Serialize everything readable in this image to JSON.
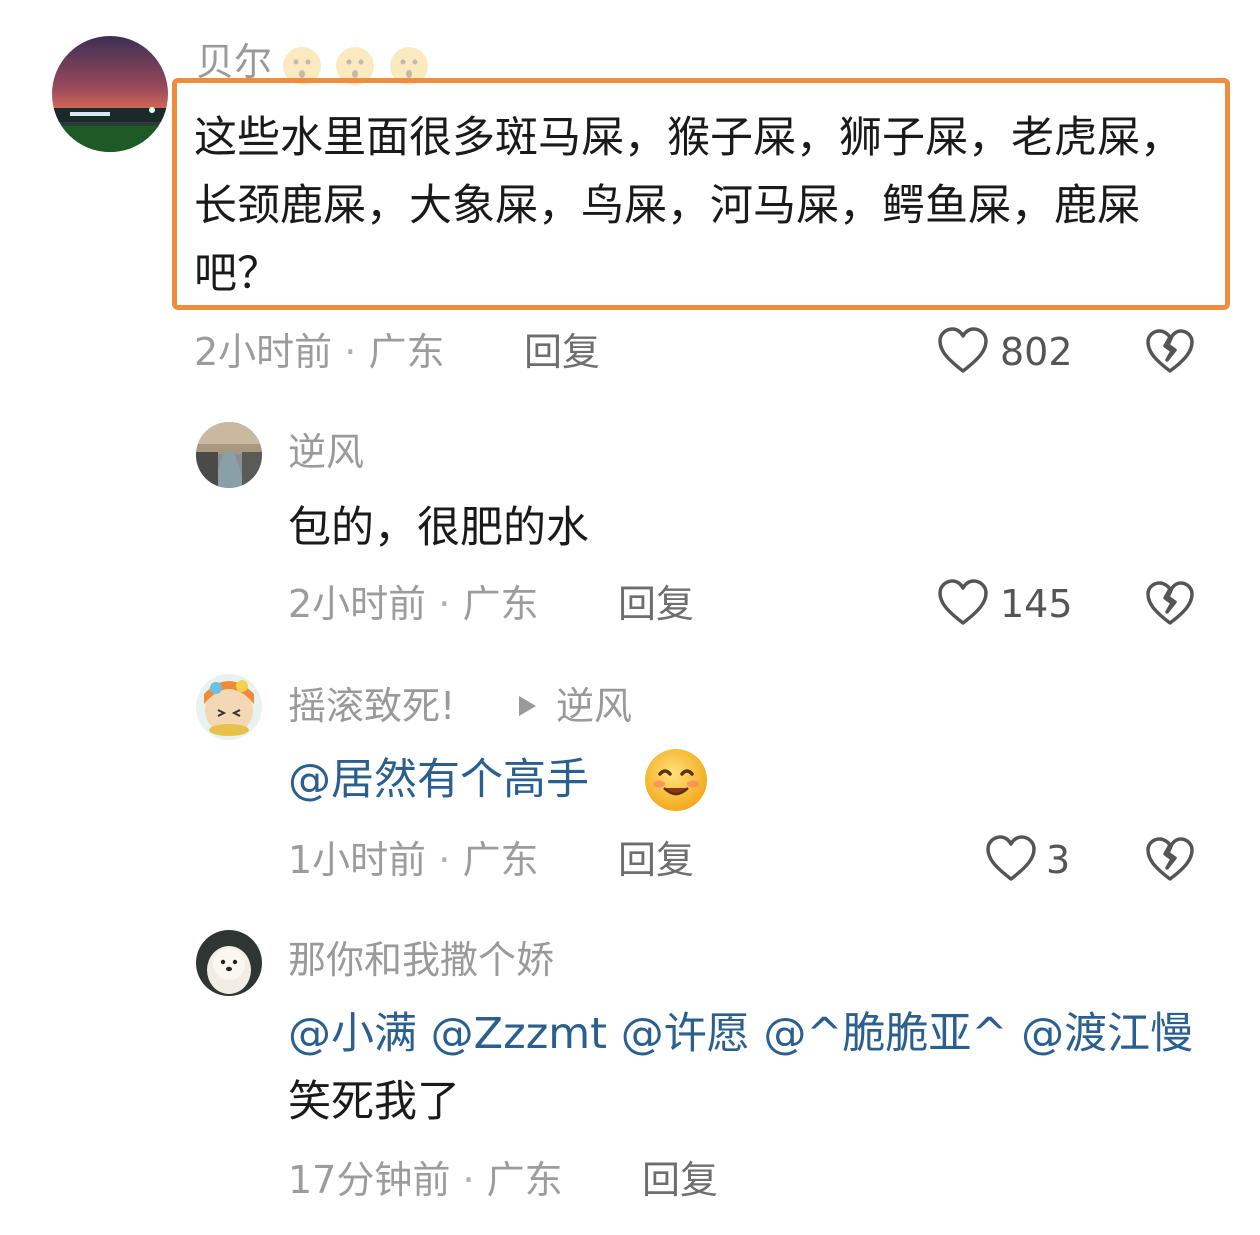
{
  "comments": [
    {
      "author": "贝尔",
      "text": "这些水里面很多斑马屎，猴子屎，狮子屎，老虎屎，长颈鹿屎，大象屎，鸟屎，河马屎，鳄鱼屎，鹿屎吧？",
      "time": "2小时前",
      "location": "广东",
      "reply": "回复",
      "likes": "802"
    },
    {
      "author": "逆风",
      "text": "包的，很肥的水",
      "time": "2小时前",
      "location": "广东",
      "reply": "回复",
      "likes": "145"
    },
    {
      "author": "摇滚致死!",
      "reply_to": "逆风",
      "mention": "@居然有个高手",
      "time": "1小时前",
      "location": "广东",
      "reply": "回复",
      "likes": "3"
    },
    {
      "author": "那你和我撒个娇",
      "mentions": [
        "@小满",
        "@Zzzmt",
        "@许愿",
        "@^脆脆亚^",
        "@渡江慢"
      ],
      "text_after": "笑死我了",
      "time": "17分钟前",
      "location": "广东",
      "reply": "回复"
    }
  ],
  "separator": "·",
  "colors": {
    "highlight_border": "#ee8d3e",
    "mention": "#2b5f8f",
    "meta": "#9c9c9c"
  },
  "icons": [
    "heart-icon",
    "broken-heart-icon",
    "triangle-right-icon",
    "smile-emoji"
  ]
}
